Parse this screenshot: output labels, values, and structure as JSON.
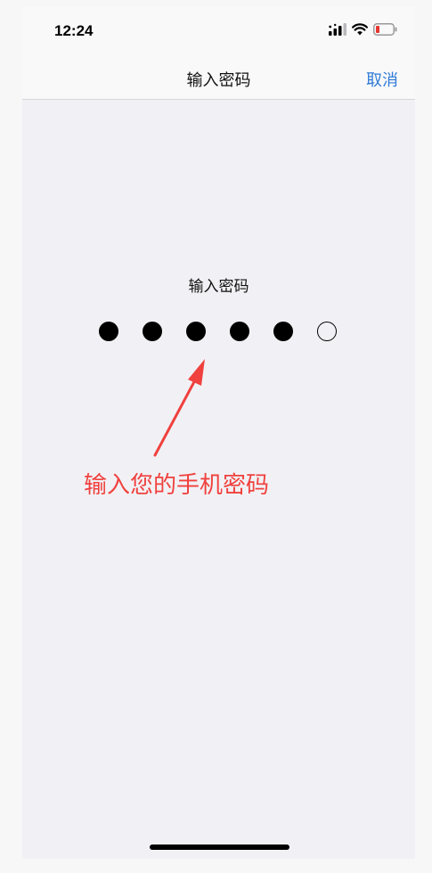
{
  "status_bar": {
    "time": "12:24",
    "icons": [
      "signal-icon",
      "wifi-icon",
      "battery-low-icon"
    ]
  },
  "nav": {
    "title": "输入密码",
    "cancel_label": "取消"
  },
  "passcode": {
    "prompt": "输入密码",
    "filled_count": 5,
    "total_count": 6
  },
  "annotation": {
    "text": "输入您的手机密码",
    "color": "#f0413e"
  },
  "colors": {
    "accent": "#2f7ad6",
    "background": "#f1f1f5"
  }
}
